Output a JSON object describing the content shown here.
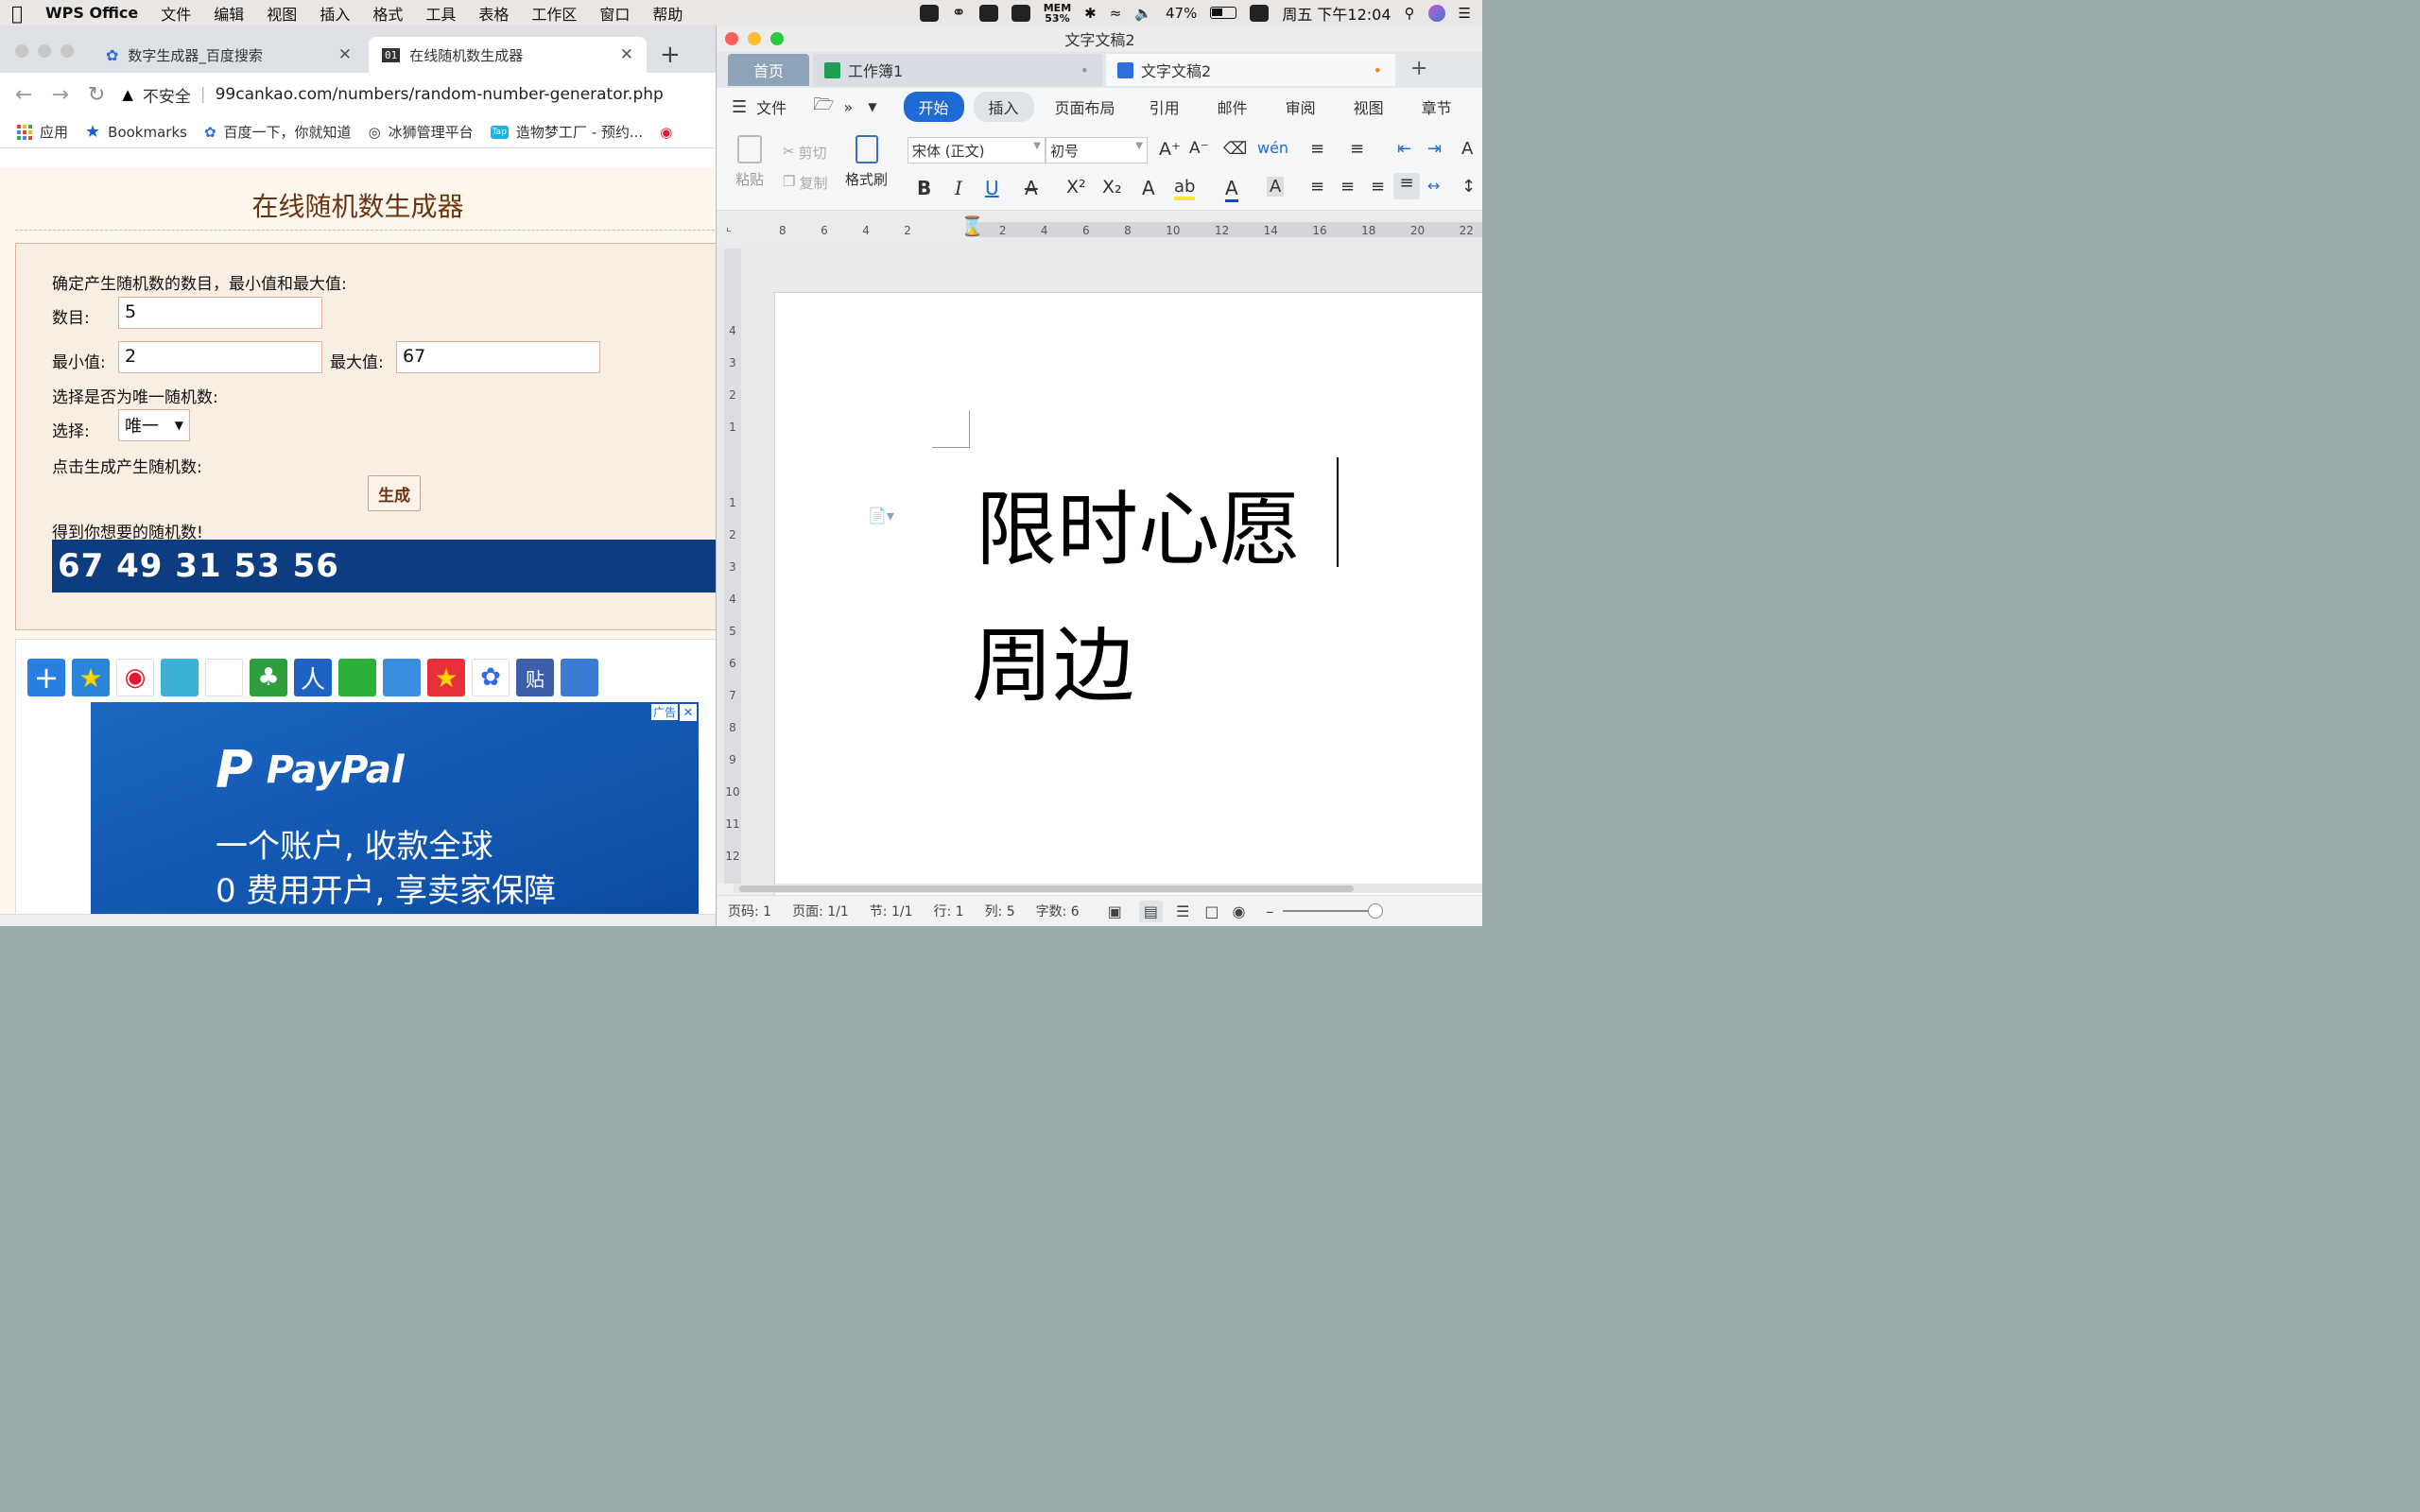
{
  "menubar": {
    "app": "WPS Office",
    "items": [
      "文件",
      "编辑",
      "视图",
      "插入",
      "格式",
      "工具",
      "表格",
      "工作区",
      "窗口",
      "帮助"
    ],
    "mem": "MEM",
    "mem_pct": "53%",
    "battery": "47%",
    "clock": "周五 下午12:04"
  },
  "browser": {
    "tabs": [
      {
        "title": "数字生成器_百度搜索"
      },
      {
        "title": "在线随机数生成器",
        "favicon_text": "01"
      }
    ],
    "new_tab": "+",
    "security": "不安全",
    "url": "99cankao.com/numbers/random-number-generator.php",
    "bookmarks": [
      "应用",
      "Bookmarks",
      "百度一下，你就知道",
      "冰狮管理平台",
      "造物梦工厂 - 预约..."
    ],
    "bookmark_tap_badge": "Tap"
  },
  "generator": {
    "title": "在线随机数生成器",
    "intro": "确定产生随机数的数目，最小值和最大值:",
    "count_label": "数目:",
    "count_value": "5",
    "min_label": "最小值:",
    "min_value": "2",
    "max_label": "最大值:",
    "max_value": "67",
    "unique_prompt": "选择是否为唯一随机数:",
    "select_label": "选择:",
    "select_value": "唯一",
    "click_prompt": "点击生成产生随机数:",
    "button": "生成",
    "result_label": "得到你想要的随机数!",
    "result": "67 49 31 53 56"
  },
  "ad": {
    "tag": "广告",
    "brand": "PayPal",
    "line1": "一个账户, 收款全球",
    "line2": "0 费用开户, 享卖家保障"
  },
  "wps": {
    "window_title": "文字文稿2",
    "tabs": [
      "首页",
      "工作簿1",
      "文字文稿2"
    ],
    "new_tab": "+",
    "menu_file": "文件",
    "ribbon_tabs": [
      "开始",
      "插入",
      "页面布局",
      "引用",
      "邮件",
      "审阅",
      "视图",
      "章节"
    ],
    "paste": "粘贴",
    "cut": "剪切",
    "copy": "复制",
    "format_painter": "格式刷",
    "font_name": "宋体 (正文)",
    "font_size": "初号",
    "doc_lines": [
      "限时心愿",
      "周边"
    ],
    "status": {
      "page_code": "页码: 1",
      "page": "页面: 1/1",
      "section": "节: 1/1",
      "row": "行: 1",
      "col": "列: 5",
      "words": "字数: 6"
    },
    "ruler_h": [
      "8",
      "6",
      "4",
      "2",
      "2",
      "4",
      "6",
      "8",
      "10",
      "12",
      "14",
      "16",
      "18",
      "20",
      "22"
    ],
    "ruler_v": [
      "4",
      "3",
      "2",
      "1",
      "1",
      "2",
      "3",
      "4",
      "5",
      "6",
      "7",
      "8",
      "9",
      "10",
      "11",
      "12"
    ]
  },
  "colors": {
    "accent_blue": "#1e6bd6",
    "result_bg": "#0d3d80",
    "title_brown": "#6b3410"
  }
}
